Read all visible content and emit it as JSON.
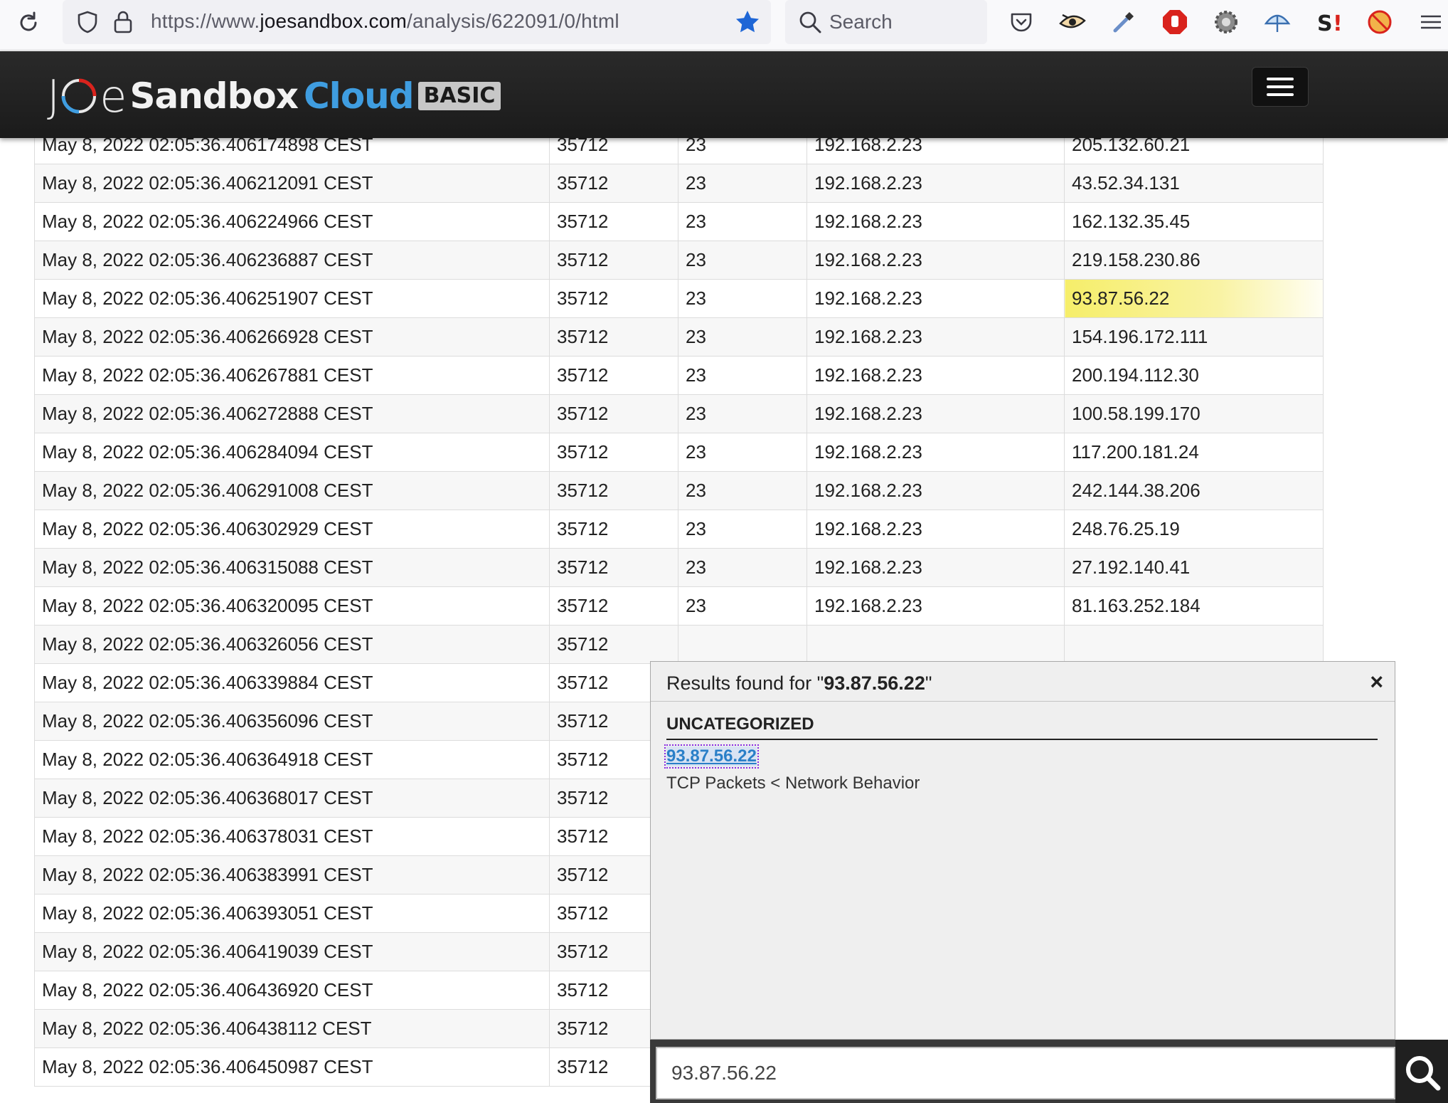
{
  "browser": {
    "url_prefix": "https://www.",
    "url_domain": "joesandbox.com",
    "url_path": "/analysis/622091/0/html",
    "search_placeholder": "Search"
  },
  "header": {
    "logo_j": "J",
    "logo_e": "e",
    "logo_sandbox": "Sandbox",
    "logo_cloud": "Cloud",
    "logo_tier": "BASIC"
  },
  "table": {
    "rows": [
      [
        "May 8, 2022 02:05:36.406174898 CEST",
        "35712",
        "23",
        "192.168.2.23",
        "205.132.60.21"
      ],
      [
        "May 8, 2022 02:05:36.406212091 CEST",
        "35712",
        "23",
        "192.168.2.23",
        "43.52.34.131"
      ],
      [
        "May 8, 2022 02:05:36.406224966 CEST",
        "35712",
        "23",
        "192.168.2.23",
        "162.132.35.45"
      ],
      [
        "May 8, 2022 02:05:36.406236887 CEST",
        "35712",
        "23",
        "192.168.2.23",
        "219.158.230.86"
      ],
      [
        "May 8, 2022 02:05:36.406251907 CEST",
        "35712",
        "23",
        "192.168.2.23",
        "93.87.56.22"
      ],
      [
        "May 8, 2022 02:05:36.406266928 CEST",
        "35712",
        "23",
        "192.168.2.23",
        "154.196.172.111"
      ],
      [
        "May 8, 2022 02:05:36.406267881 CEST",
        "35712",
        "23",
        "192.168.2.23",
        "200.194.112.30"
      ],
      [
        "May 8, 2022 02:05:36.406272888 CEST",
        "35712",
        "23",
        "192.168.2.23",
        "100.58.199.170"
      ],
      [
        "May 8, 2022 02:05:36.406284094 CEST",
        "35712",
        "23",
        "192.168.2.23",
        "117.200.181.24"
      ],
      [
        "May 8, 2022 02:05:36.406291008 CEST",
        "35712",
        "23",
        "192.168.2.23",
        "242.144.38.206"
      ],
      [
        "May 8, 2022 02:05:36.406302929 CEST",
        "35712",
        "23",
        "192.168.2.23",
        "248.76.25.19"
      ],
      [
        "May 8, 2022 02:05:36.406315088 CEST",
        "35712",
        "23",
        "192.168.2.23",
        "27.192.140.41"
      ],
      [
        "May 8, 2022 02:05:36.406320095 CEST",
        "35712",
        "23",
        "192.168.2.23",
        "81.163.252.184"
      ],
      [
        "May 8, 2022 02:05:36.406326056 CEST",
        "35712",
        "",
        "",
        ""
      ],
      [
        "May 8, 2022 02:05:36.406339884 CEST",
        "35712",
        "",
        "",
        ""
      ],
      [
        "May 8, 2022 02:05:36.406356096 CEST",
        "35712",
        "",
        "",
        ""
      ],
      [
        "May 8, 2022 02:05:36.406364918 CEST",
        "35712",
        "",
        "",
        ""
      ],
      [
        "May 8, 2022 02:05:36.406368017 CEST",
        "35712",
        "",
        "",
        ""
      ],
      [
        "May 8, 2022 02:05:36.406378031 CEST",
        "35712",
        "",
        "",
        ""
      ],
      [
        "May 8, 2022 02:05:36.406383991 CEST",
        "35712",
        "",
        "",
        ""
      ],
      [
        "May 8, 2022 02:05:36.406393051 CEST",
        "35712",
        "",
        "",
        ""
      ],
      [
        "May 8, 2022 02:05:36.406419039 CEST",
        "35712",
        "",
        "",
        ""
      ],
      [
        "May 8, 2022 02:05:36.406436920 CEST",
        "35712",
        "",
        "",
        ""
      ],
      [
        "May 8, 2022 02:05:36.406438112 CEST",
        "35712",
        "",
        "",
        ""
      ],
      [
        "May 8, 2022 02:05:36.406450987 CEST",
        "35712",
        "",
        "",
        ""
      ]
    ],
    "highlight_row": 4,
    "highlight_col": 4
  },
  "popup": {
    "title_prefix": "Results found for \"",
    "title_query": "93.87.56.22",
    "title_suffix": "\"",
    "close": "×",
    "category": "UNCATEGORIZED",
    "result_link": "93.87.56.22",
    "result_path": "TCP Packets < Network Behavior"
  },
  "search": {
    "value": "93.87.56.22"
  },
  "colors": {
    "accent_blue": "#3f9de0",
    "highlight_yellow": "#f6ee6a",
    "header_dark": "#1b1b1b"
  },
  "icons": [
    "reload-icon",
    "shield-icon",
    "lock-icon",
    "bookmark-star-icon",
    "search-icon",
    "pocket-icon",
    "eye-extension-icon",
    "eyedropper-icon",
    "adblock-icon",
    "gear-extension-icon",
    "vpn-extension-icon",
    "s-extension-icon",
    "blocked-extension-icon",
    "menu-icon"
  ]
}
